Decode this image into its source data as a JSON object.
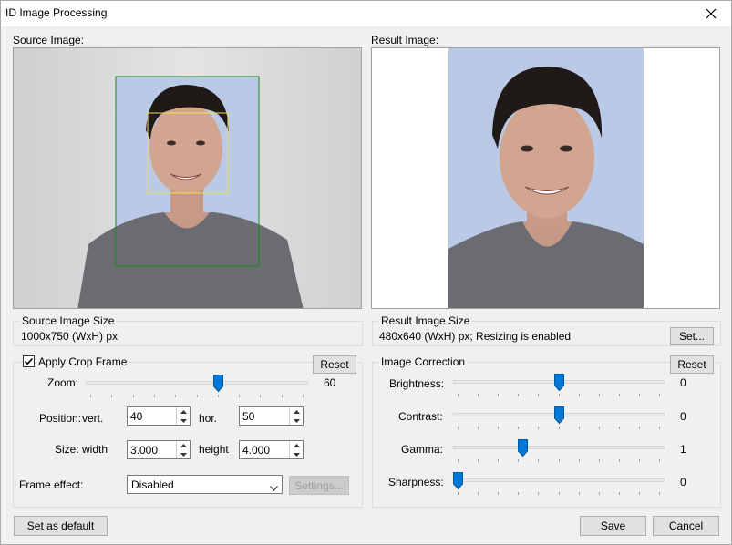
{
  "window": {
    "title": "ID Image Processing"
  },
  "source": {
    "label": "Source Image:",
    "size_group": "Source Image Size",
    "size_value": "1000x750 (WxH) px"
  },
  "result": {
    "label": "Result Image:",
    "size_group": "Result Image Size",
    "size_value": "480x640 (WxH) px; Resizing is enabled",
    "set_button": "Set..."
  },
  "crop": {
    "checkbox_label": "Apply Crop Frame",
    "checked": true,
    "reset_button": "Reset",
    "zoom_label": "Zoom:",
    "zoom_value": "60",
    "zoom_level": 0.6,
    "position_label": "Position:",
    "vert_label": "vert.",
    "vert_value": "40",
    "hor_label": "hor.",
    "hor_value": "50",
    "size_label": "Size:",
    "width_label": "width",
    "width_value": "3.000",
    "height_label": "height",
    "height_value": "4.000",
    "frame_effect_label": "Frame effect:",
    "frame_effect_value": "Disabled",
    "settings_button": "Settings..."
  },
  "correction": {
    "group_label": "Image Correction",
    "reset_button": "Reset",
    "brightness_label": "Brightness:",
    "brightness_value": "0",
    "brightness_level": 0.5,
    "contrast_label": "Contrast:",
    "contrast_value": "0",
    "contrast_level": 0.5,
    "gamma_label": "Gamma:",
    "gamma_value": "1",
    "gamma_level": 0.32,
    "sharpness_label": "Sharpness:",
    "sharpness_value": "0",
    "sharpness_level": 0.0
  },
  "footer": {
    "set_default_button": "Set as default",
    "save_button": "Save",
    "cancel_button": "Cancel"
  },
  "icons": [
    "close-icon",
    "checkmark-icon",
    "spin-up-icon",
    "spin-down-icon",
    "dropdown-arrow-icon"
  ]
}
